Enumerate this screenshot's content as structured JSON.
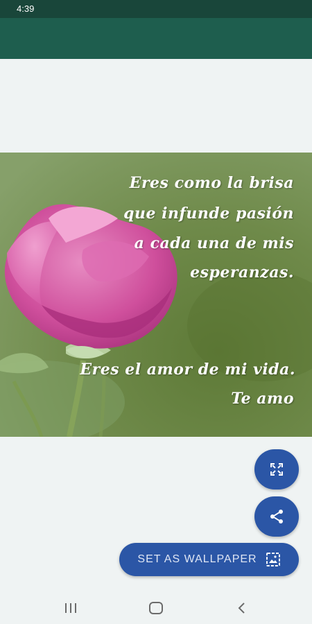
{
  "status_bar": {
    "time": "4:39"
  },
  "wallpaper": {
    "quote_lines": [
      "Eres como la brisa",
      "que infunde pasión",
      "a cada una de mis",
      "esperanzas.",
      "Eres el amor de mi vida.",
      "Te amo"
    ]
  },
  "actions": {
    "expand_icon": "fullscreen-icon",
    "share_icon": "share-icon",
    "set_wallpaper_label": "SET AS WALLPAPER",
    "set_wallpaper_icon": "wallpaper-icon"
  },
  "nav_bar": {
    "recents_icon": "recents-icon",
    "home_icon": "home-icon",
    "back_icon": "back-icon"
  },
  "colors": {
    "status_bar": "#19463a",
    "app_bar": "#1e5e4e",
    "accent": "#2b56a6",
    "background": "#eff3f3"
  }
}
